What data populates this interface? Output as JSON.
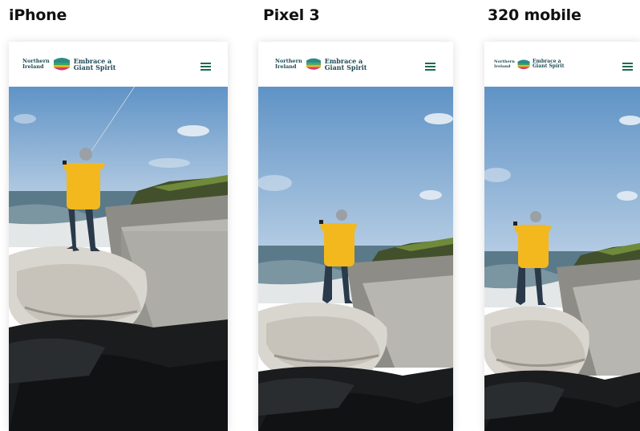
{
  "devices": [
    {
      "label": "iPhone"
    },
    {
      "label": "Pixel 3"
    },
    {
      "label": "320 mobile"
    }
  ],
  "logo": {
    "gov_line1": "Northern",
    "gov_line2": "Ireland",
    "brand_line1": "Embrace a",
    "brand_line2": "Giant Spirit"
  },
  "icons": {
    "menu": "hamburger-menu-icon",
    "logo_mark": "stripes-mark-icon"
  },
  "colors": {
    "coat": "#f2b81e",
    "sky": "#6c9fd0",
    "menu": "#1c6b50"
  }
}
